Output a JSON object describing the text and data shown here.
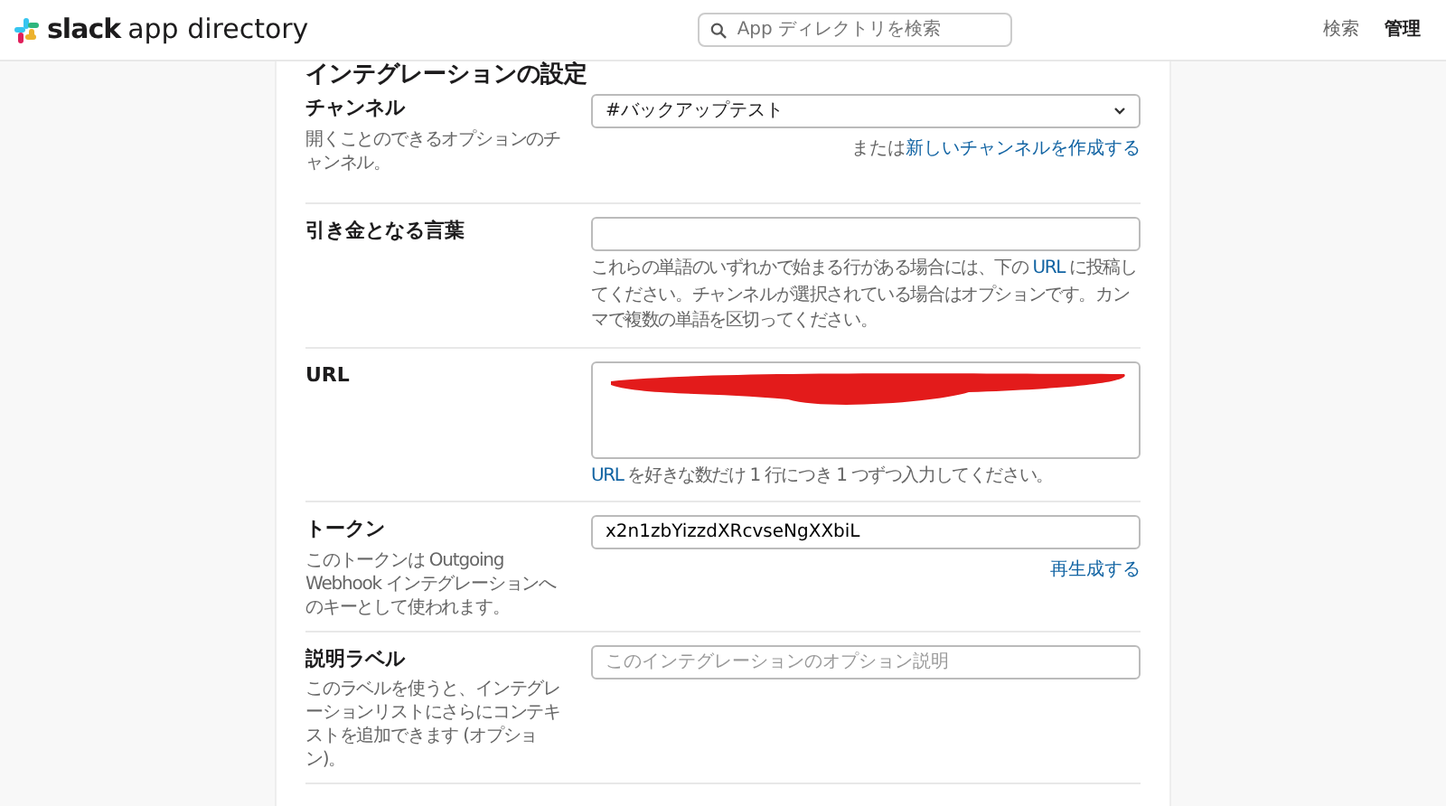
{
  "header": {
    "logo_bold": "slack",
    "logo_rest": "app directory",
    "search": {
      "placeholder": "App ディレクトリを検索"
    },
    "nav": [
      {
        "label": "検索",
        "selected": false
      },
      {
        "label": "管理",
        "selected": true
      }
    ]
  },
  "section_title": "インテグレーションの設定",
  "fields": [
    {
      "kind": "select",
      "label": "チャンネル",
      "description": [
        {
          "text": "開くことのできるオプションのチャンネル。",
          "link": false
        }
      ],
      "value": "#バックアップテスト",
      "action": [
        {
          "text": "または",
          "link": false
        },
        {
          "text": "新しいチャンネルを作成する",
          "link": true
        }
      ]
    },
    {
      "kind": "text",
      "label": "引き金となる言葉",
      "hint": [
        {
          "text": "これらの単語のいずれかで始まる行がある場合には、下の ",
          "link": false
        },
        {
          "text": "URL",
          "link": true
        },
        {
          "text": " に投稿してください。チャンネルが選択されている場合はオプションです。カンマで複数の単語を区切ってください。",
          "link": false
        }
      ]
    },
    {
      "kind": "textarea",
      "label": "URL",
      "redacted": true,
      "hint": [
        {
          "text": "URL",
          "link": true
        },
        {
          "text": " を好きな数だけ 1 行につき 1 つずつ入力してください。",
          "link": false
        }
      ]
    },
    {
      "kind": "text",
      "label": "トークン",
      "description": [
        {
          "text": "このトークンは Outgoing Webhook インテグレーションへのキーとして使われます。",
          "link": false
        }
      ],
      "value": "x2n1zbYizzdXRcvseNgXXbiL",
      "action": [
        {
          "text": "再生成する",
          "link": true
        }
      ]
    },
    {
      "kind": "text",
      "label": "説明ラベル",
      "description": [
        {
          "text": "このラベルを使うと、インテグレーションリストにさらにコンテキストを追加できます (オプション)。",
          "link": false
        }
      ],
      "placeholder": "このインテグレーションのオプション説明"
    }
  ]
}
